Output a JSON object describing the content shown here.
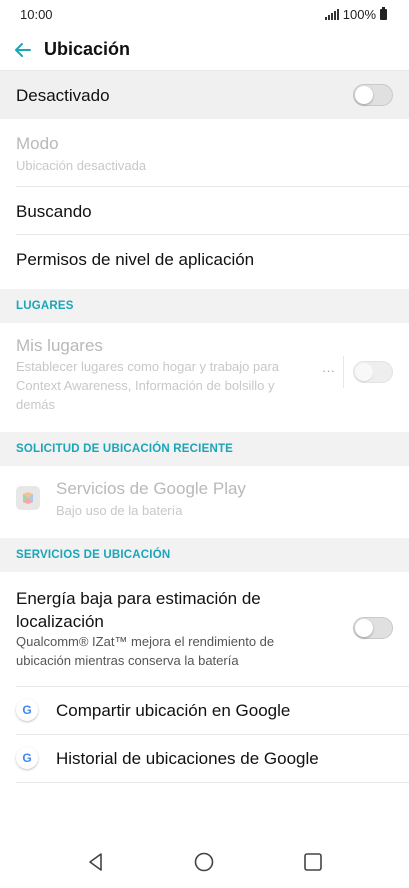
{
  "status_bar": {
    "time": "10:00",
    "battery": "100%"
  },
  "header": {
    "title": "Ubicación"
  },
  "master_toggle": {
    "label": "Desactivado",
    "state": "off"
  },
  "mode": {
    "label": "Modo",
    "summary": "Ubicación desactivada"
  },
  "searching": {
    "label": "Buscando"
  },
  "app_permissions": {
    "label": "Permisos de nivel de aplicación"
  },
  "places": {
    "header": "LUGARES",
    "item": {
      "label": "Mis lugares",
      "summary_line1": "Establecer lugares como hogar y trabajo para",
      "summary_line2": "Context Awareness, Información de bolsillo y",
      "summary_line3": "demás",
      "more": "···",
      "state": "off"
    }
  },
  "recent": {
    "header": "SOLICITUD DE UBICACIÓN RECIENTE",
    "item": {
      "label": "Servicios de Google Play",
      "summary": "Bajo uso de la batería",
      "icon": "google-play-services-icon"
    }
  },
  "services": {
    "header": "SERVICIOS DE UBICACIÓN",
    "low_power": {
      "label_line1": "Energía baja para estimación de",
      "label_line2": "localización",
      "summary_line1": "Qualcomm® IZat™ mejora el rendimiento de",
      "summary_line2": "ubicación mientras conserva la batería",
      "state": "off"
    },
    "share": {
      "label": "Compartir ubicación en Google",
      "icon": "google-icon",
      "icon_glyph": "G"
    },
    "history": {
      "label": "Historial de ubicaciones de Google",
      "icon": "google-icon",
      "icon_glyph": "G"
    }
  },
  "colors": {
    "accent": "#1aa5b8",
    "section_bg": "#f2f2f2",
    "highlight_row": "#f0f0f0",
    "disabled_text": "#b9b9b9"
  }
}
